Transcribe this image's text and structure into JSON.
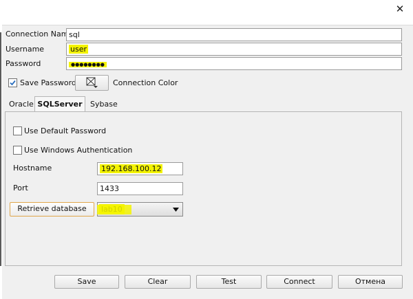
{
  "window": {
    "close_glyph": "✕"
  },
  "connection": {
    "name_label": "Connection Name",
    "name_value": "sql",
    "username_label": "Username",
    "username_value": "user",
    "password_label": "Password",
    "password_value": "●●●●●●●●",
    "save_password_label": "Save Password",
    "save_password_checked": true,
    "connection_color_label": "Connection Color"
  },
  "tabs": [
    {
      "label": "Oracle",
      "active": false
    },
    {
      "label": "SQLServer",
      "active": true
    },
    {
      "label": "Sybase",
      "active": false
    }
  ],
  "sqlserver": {
    "default_password_label": "Use Default Password",
    "windows_auth_label": "Use Windows Authentication",
    "hostname_label": "Hostname",
    "hostname_value": "192.168.100.12",
    "port_label": "Port",
    "port_value": "1433",
    "retrieve_button_label": "Retrieve database",
    "database_value": "lab10"
  },
  "footer": {
    "save": "Save",
    "clear": "Clear",
    "test": "Test",
    "connect": "Connect",
    "cancel": "Отмена"
  },
  "colors": {
    "highlight": "#f3f300",
    "panel": "#eeeeee",
    "check_accent": "#2a6ebd"
  }
}
